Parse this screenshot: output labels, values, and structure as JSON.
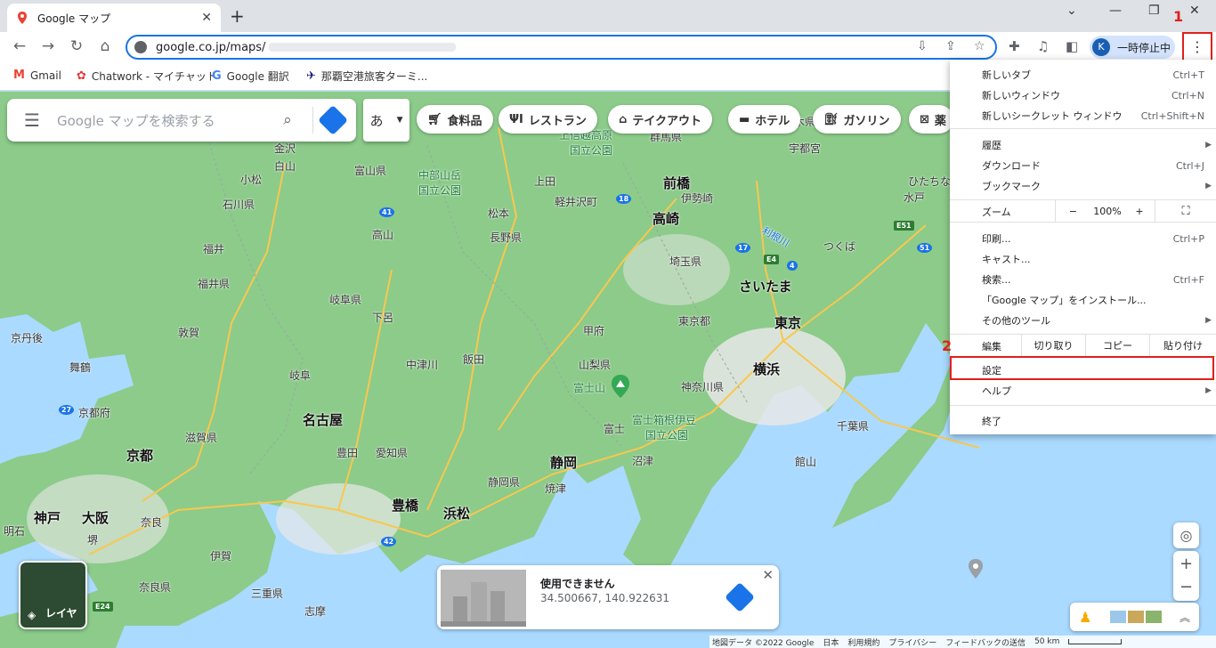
{
  "browser": {
    "tab_title": "Google マップ",
    "url": "google.co.jp/maps/",
    "profile_initial": "K",
    "profile_status": "一時停止中"
  },
  "bookmarks": [
    {
      "label": "Gmail"
    },
    {
      "label": "Chatwork - マイチャット"
    },
    {
      "label": "Google 翻訳"
    },
    {
      "label": "那覇空港旅客ターミ..."
    }
  ],
  "annotations": {
    "step1": "1",
    "step2": "2"
  },
  "map": {
    "search_placeholder": "Google マップを検索する",
    "ime_label": "あ",
    "chips": [
      {
        "label": "食料品",
        "icon": "cart-icon"
      },
      {
        "label": "レストラン",
        "icon": "fork-knife-icon"
      },
      {
        "label": "テイクアウト",
        "icon": "takeout-icon"
      },
      {
        "label": "ホテル",
        "icon": "bed-icon"
      },
      {
        "label": "ガソリン",
        "icon": "fuel-icon"
      },
      {
        "label": "薬",
        "icon": "pharmacy-icon"
      }
    ],
    "labels": {
      "kanazawa": "金沢",
      "hakusan": "白山",
      "komatsu": "小松",
      "ishikawa": "石川県",
      "toyama": "富山県",
      "chubu": "中部山岳",
      "chubu2": "国立公園",
      "joshin": "上信越高原",
      "joshin2": "国立公園",
      "gunma": "群馬県",
      "utsunomiya": "宇都宮",
      "tochigi": "栃木県",
      "jouden": "上田",
      "karuizawa": "軽井沢町",
      "maebashi": "前橋",
      "isesaki": "伊勢崎",
      "takasaki": "高崎",
      "hitachinaka": "ひたちなか",
      "mito": "水戸",
      "tsukuba": "つくば",
      "matsumoto": "松本",
      "nagano": "長野県",
      "takayama": "高山",
      "fukui_city": "福井",
      "fukui": "福井県",
      "saitama_pref": "埼玉県",
      "saitama": "さいたま",
      "tone": "利根川",
      "gifu": "岐阜県",
      "gero": "下呂",
      "tokyo_pref": "東京都",
      "tokyo": "東京",
      "kofu": "甲府",
      "kyotango": "京丹後",
      "tsuruga": "敦賀",
      "maizuru": "舞鶴",
      "nakatsugawa": "中津川",
      "iida": "飯田",
      "yamanashi": "山梨県",
      "yokohama": "横浜",
      "gifu_city": "岐阜",
      "fuji": "富士山",
      "kanagawa": "神奈川県",
      "kyoto_pref": "京都府",
      "nagoya": "名古屋",
      "fujihakone": "富士箱根伊豆",
      "fujihakone2": "国立公園",
      "chiba": "千葉県",
      "shiga": "滋賀県",
      "fuji_city": "富士",
      "kyoto": "京都",
      "toyota": "豊田",
      "aichi": "愛知県",
      "shizuoka": "静岡",
      "numazu": "沼津",
      "tateyama": "館山",
      "shizuoka_pref": "静岡県",
      "yaizu": "焼津",
      "toyohashi": "豊橋",
      "kobe": "神戸",
      "osaka": "大阪",
      "hamamatsu": "浜松",
      "nara_city": "奈良",
      "akashi": "明石",
      "sakai": "堺",
      "iga": "伊賀",
      "nara": "奈良県",
      "mie": "三重県",
      "shima": "志摩",
      "layer_label": "レイヤ"
    },
    "route_shields": [
      "41",
      "18",
      "17",
      "4",
      "51",
      "27",
      "42",
      "E51",
      "E4",
      "E24"
    ],
    "info_card": {
      "title": "使用できません",
      "coords": "34.500667, 140.922631"
    },
    "footer": {
      "mapdata": "地図データ ©2022 Google",
      "country": "日本",
      "terms": "利用規約",
      "privacy": "プライバシー",
      "feedback": "フィードバックの送信",
      "scale": "50 km"
    }
  },
  "menu": {
    "new_tab": "新しいタブ",
    "new_tab_sc": "Ctrl+T",
    "new_window": "新しいウィンドウ",
    "new_window_sc": "Ctrl+N",
    "new_incognito": "新しいシークレット ウィンドウ",
    "new_incognito_sc": "Ctrl+Shift+N",
    "history": "履歴",
    "downloads": "ダウンロード",
    "downloads_sc": "Ctrl+J",
    "bookmarks": "ブックマーク",
    "zoom": "ズーム",
    "zoom_minus": "−",
    "zoom_value": "100%",
    "zoom_plus": "+",
    "print": "印刷...",
    "print_sc": "Ctrl+P",
    "cast": "キャスト...",
    "find": "検索...",
    "find_sc": "Ctrl+F",
    "install": "「Google マップ」をインストール...",
    "more_tools": "その他のツール",
    "edit": "編集",
    "cut": "切り取り",
    "copy": "コピー",
    "paste": "貼り付け",
    "settings": "設定",
    "help": "ヘルプ",
    "exit": "終了"
  },
  "colors": {
    "accent": "#1a73e8",
    "highlight": "#e0201b",
    "land": "#8ccb8a",
    "sea": "#aadaff",
    "urban": "#e8e8e8"
  }
}
